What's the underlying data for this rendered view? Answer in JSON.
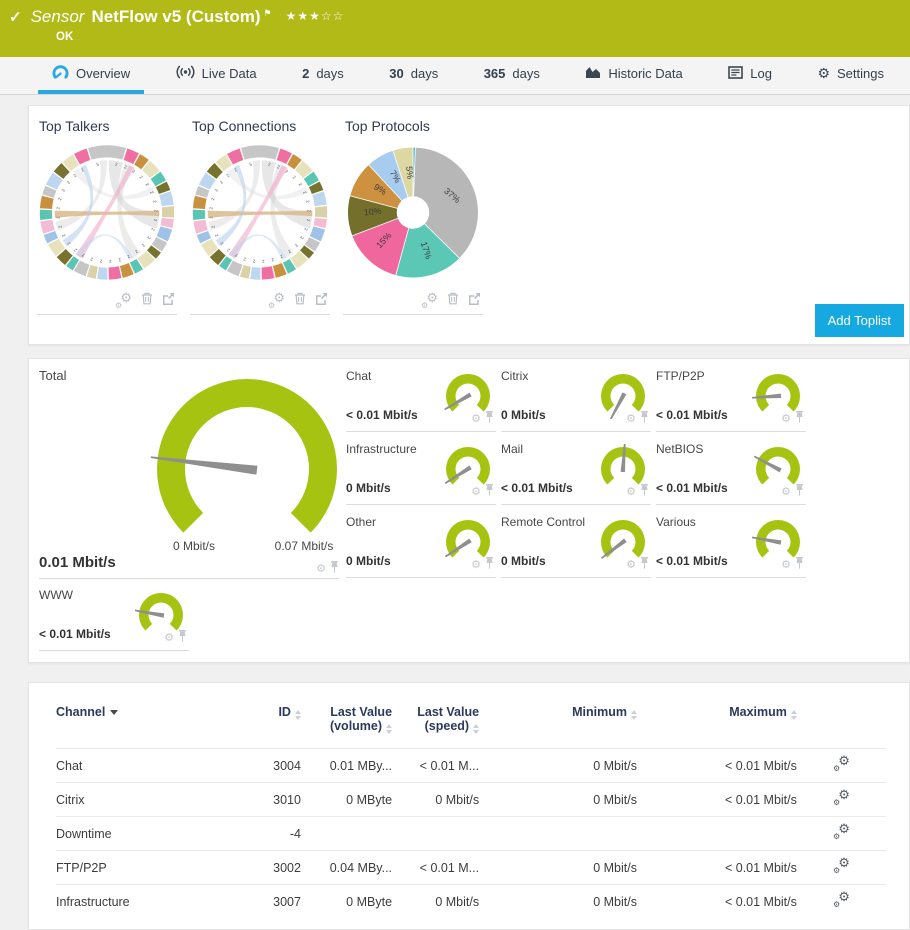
{
  "header": {
    "kind_label": "Sensor",
    "title": "NetFlow v5 (Custom)",
    "status": "OK",
    "stars_filled": "★★★",
    "stars_empty": "☆☆",
    "color": "#b1ba17"
  },
  "tabs": [
    {
      "id": "overview",
      "icon": "gauge-icon",
      "label": "Overview",
      "active": true
    },
    {
      "id": "live-data",
      "icon": "broadcast-icon",
      "label": "Live Data"
    },
    {
      "id": "2-days",
      "num": "2",
      "label": "days"
    },
    {
      "id": "30-days",
      "num": "30",
      "label": "days"
    },
    {
      "id": "365-days",
      "num": "365",
      "label": "days"
    },
    {
      "id": "historic-data",
      "icon": "historic-icon",
      "label": "Historic Data"
    },
    {
      "id": "log",
      "icon": "log-icon",
      "label": "Log"
    },
    {
      "id": "settings",
      "icon": "settings-icon",
      "label": "Settings"
    }
  ],
  "toplists": {
    "add_button": "Add Toplist",
    "charts": [
      {
        "title": "Top Talkers",
        "type": "chord"
      },
      {
        "title": "Top Connections",
        "type": "chord"
      },
      {
        "title": "Top Protocols",
        "type": "pie"
      }
    ]
  },
  "chart_data": [
    {
      "type": "chord",
      "title": "Top Talkers",
      "start_deg": -17,
      "segments": [
        {
          "size": 34,
          "color": "#c6c6c6"
        },
        {
          "size": 12,
          "color": "#f06ea1"
        },
        {
          "size": 10,
          "color": "#c9913f"
        },
        {
          "size": 13,
          "color": "#e8e2bc"
        },
        {
          "size": 10,
          "color": "#5ac5b2"
        },
        {
          "size": 9,
          "color": "#77732f"
        },
        {
          "size": 13,
          "color": "#bdd7f1"
        },
        {
          "size": 11,
          "color": "#d9d2a8"
        },
        {
          "size": 9,
          "color": "#f3bcd4"
        },
        {
          "size": 12,
          "color": "#9fc3e8"
        },
        {
          "size": 10,
          "color": "#c6c6c6"
        },
        {
          "size": 8,
          "color": "#77732f"
        },
        {
          "size": 13,
          "color": "#e8e2bc"
        },
        {
          "size": 9,
          "color": "#5ac5b2"
        },
        {
          "size": 11,
          "color": "#c9913f"
        },
        {
          "size": 12,
          "color": "#f06ea1"
        },
        {
          "size": 10,
          "color": "#bdd7f1"
        },
        {
          "size": 9,
          "color": "#d9d2a8"
        },
        {
          "size": 12,
          "color": "#c6c6c6"
        },
        {
          "size": 8,
          "color": "#5ac5b2"
        },
        {
          "size": 11,
          "color": "#77732f"
        },
        {
          "size": 13,
          "color": "#e8e2bc"
        },
        {
          "size": 9,
          "color": "#9fc3e8"
        },
        {
          "size": 12,
          "color": "#f3bcd4"
        },
        {
          "size": 10,
          "color": "#5ac5b2"
        },
        {
          "size": 12,
          "color": "#c9913f"
        },
        {
          "size": 9,
          "color": "#c6c6c6"
        },
        {
          "size": 13,
          "color": "#bdd7f1"
        },
        {
          "size": 11,
          "color": "#77732f"
        },
        {
          "size": 12,
          "color": "#e8e2bc"
        },
        {
          "size": 13,
          "color": "#f06ea1"
        }
      ],
      "ribbons": [
        {
          "a": 2,
          "aw": 16,
          "b": 88,
          "bw": 20,
          "color": "#d0d0d0",
          "op": 0.5
        },
        {
          "a": 20,
          "aw": 10,
          "b": 140,
          "bw": 12,
          "color": "#d0d0d0",
          "op": 0.4
        },
        {
          "a": 352,
          "aw": 8,
          "b": 250,
          "bw": 10,
          "color": "#cfcfcf",
          "op": 0.4
        },
        {
          "a": 88,
          "aw": 6,
          "b": 264,
          "bw": 8,
          "color": "#d9b98c",
          "op": 0.85
        },
        {
          "a": 25,
          "aw": 7,
          "b": 208,
          "bw": 9,
          "color": "#f2aac9",
          "op": 0.6
        },
        {
          "a": 330,
          "aw": 6,
          "b": 230,
          "bw": 8,
          "color": "#a9c7ea",
          "op": 0.5
        },
        {
          "a": 150,
          "aw": 5,
          "b": 210,
          "bw": 6,
          "color": "#bcd4ee",
          "op": 0.5
        },
        {
          "a": 60,
          "aw": 8,
          "b": 320,
          "bw": 8,
          "color": "#d6d6d6",
          "op": 0.35
        }
      ],
      "numbers": {
        "char": "2",
        "start": 22,
        "end": 338,
        "step": 11,
        "extras": [
          {
            "deg": 349,
            "char": "5"
          },
          {
            "deg": 11,
            "char": "2"
          }
        ]
      }
    },
    {
      "type": "chord",
      "title": "Top Connections",
      "config_of": 0
    },
    {
      "type": "pie",
      "title": "Top Protocols",
      "hole": 17,
      "radius": 70,
      "slices": [
        {
          "pct": 0.6,
          "color": "#42bdc4",
          "label": "",
          "label_rot": 0
        },
        {
          "pct": 37,
          "color": "#b7b7b7",
          "label": "37%",
          "label_rot": 40
        },
        {
          "pct": 17,
          "color": "#5bc8b6",
          "label": "17%",
          "label_rot": 72
        },
        {
          "pct": 15,
          "color": "#f0679e",
          "label": "15%",
          "label_rot": -47
        },
        {
          "pct": 10,
          "color": "#74702c",
          "label": "10%",
          "label_rot": -5
        },
        {
          "pct": 9,
          "color": "#cd9140",
          "label": "9%",
          "label_rot": 32
        },
        {
          "pct": 7,
          "color": "#a8cbf0",
          "label": "7%",
          "label_rot": 60
        },
        {
          "pct": 5,
          "color": "#ddd7a2",
          "label": "5%",
          "label_rot": 84
        }
      ]
    }
  ],
  "gauges": {
    "arc_color": "#a6c311",
    "needle_color": "#8f8f8f",
    "total": {
      "label": "Total",
      "value": "0.01 Mbit/s",
      "min": "0 Mbit/s",
      "max": "0.07 Mbit/s",
      "value_mbit": 0.01,
      "min_mbit": 0,
      "max_mbit": 0.07,
      "needle_deg": 187
    },
    "channels": [
      {
        "label": "Chat",
        "value": "< 0.01 Mbit/s",
        "needle_deg": 150
      },
      {
        "label": "Citrix",
        "value": "0 Mbit/s",
        "needle_deg": 118
      },
      {
        "label": "FTP/P2P",
        "value": "< 0.01 Mbit/s",
        "needle_deg": 176
      },
      {
        "label": "Infrastructure",
        "value": "0 Mbit/s",
        "needle_deg": 148
      },
      {
        "label": "Mail",
        "value": "< 0.01 Mbit/s",
        "needle_deg": 274
      },
      {
        "label": "NetBIOS",
        "value": "< 0.01 Mbit/s",
        "needle_deg": 208
      },
      {
        "label": "Other",
        "value": "0 Mbit/s",
        "needle_deg": 147
      },
      {
        "label": "Remote Control",
        "value": "0 Mbit/s",
        "needle_deg": 143
      },
      {
        "label": "Various",
        "value": "< 0.01 Mbit/s",
        "needle_deg": 190
      }
    ],
    "www": {
      "label": "WWW",
      "value": "< 0.01 Mbit/s",
      "needle_deg": 190
    }
  },
  "table": {
    "columns": [
      "Channel",
      "ID",
      "Last Value (volume)",
      "Last Value (speed)",
      "Minimum",
      "Maximum"
    ],
    "rows": [
      {
        "channel": "Chat",
        "id": "3004",
        "lvv": "0.01 MBy...",
        "lvs": "< 0.01 M...",
        "min": "0 Mbit/s",
        "max": "< 0.01 Mbit/s"
      },
      {
        "channel": "Citrix",
        "id": "3010",
        "lvv": "0 MByte",
        "lvs": "0 Mbit/s",
        "min": "0 Mbit/s",
        "max": "< 0.01 Mbit/s"
      },
      {
        "channel": "Downtime",
        "id": "-4",
        "lvv": "",
        "lvs": "",
        "min": "",
        "max": ""
      },
      {
        "channel": "FTP/P2P",
        "id": "3002",
        "lvv": "0.04 MBy...",
        "lvs": "< 0.01 M...",
        "min": "0 Mbit/s",
        "max": "< 0.01 Mbit/s"
      },
      {
        "channel": "Infrastructure",
        "id": "3007",
        "lvv": "0 MByte",
        "lvs": "0 Mbit/s",
        "min": "0 Mbit/s",
        "max": "< 0.01 Mbit/s"
      }
    ]
  }
}
